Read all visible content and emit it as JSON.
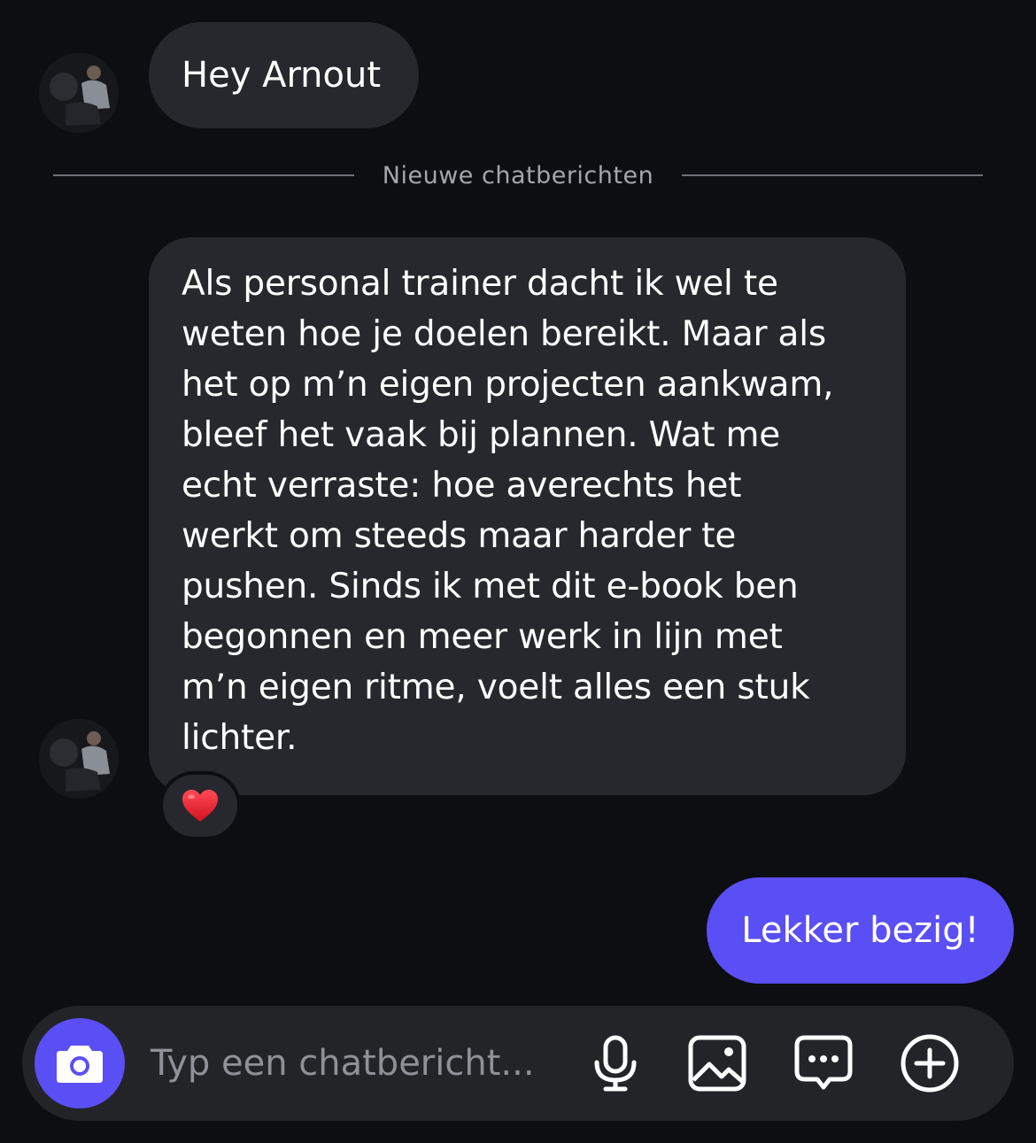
{
  "messages": [
    {
      "direction": "incoming",
      "text": "Hey Arnout"
    },
    {
      "direction": "incoming",
      "lines": [
        "Als personal trainer dacht ik wel te",
        "weten hoe je doelen bereikt. Maar als",
        "het op m’n eigen projecten aankwam,",
        "bleef het vaak bij plannen. Wat me",
        "echt verraste: hoe averechts het",
        "werkt om steeds maar harder te",
        "pushen. Sinds ik met dit e-book ben",
        "begonnen en meer werk in lijn met",
        "m’n eigen ritme, voelt alles een stuk",
        "lichter."
      ],
      "reaction": "❤️"
    },
    {
      "direction": "outgoing",
      "text": "Lekker bezig!"
    }
  ],
  "divider": {
    "label": "Nieuwe chatberichten"
  },
  "composer": {
    "placeholder": "Typ een chatbericht...",
    "tools": [
      "camera-icon",
      "microphone-icon",
      "image-icon",
      "chat-bubble-icon",
      "plus-circle-icon"
    ]
  },
  "colors": {
    "background": "#0c0e12",
    "incoming_bubble": "#26282d",
    "outgoing_bubble": "#5a4ff5",
    "accent": "#5a4ff5",
    "divider_text": "#a3a6ad",
    "placeholder_text": "#8e9198",
    "heart": "#e0202c"
  }
}
